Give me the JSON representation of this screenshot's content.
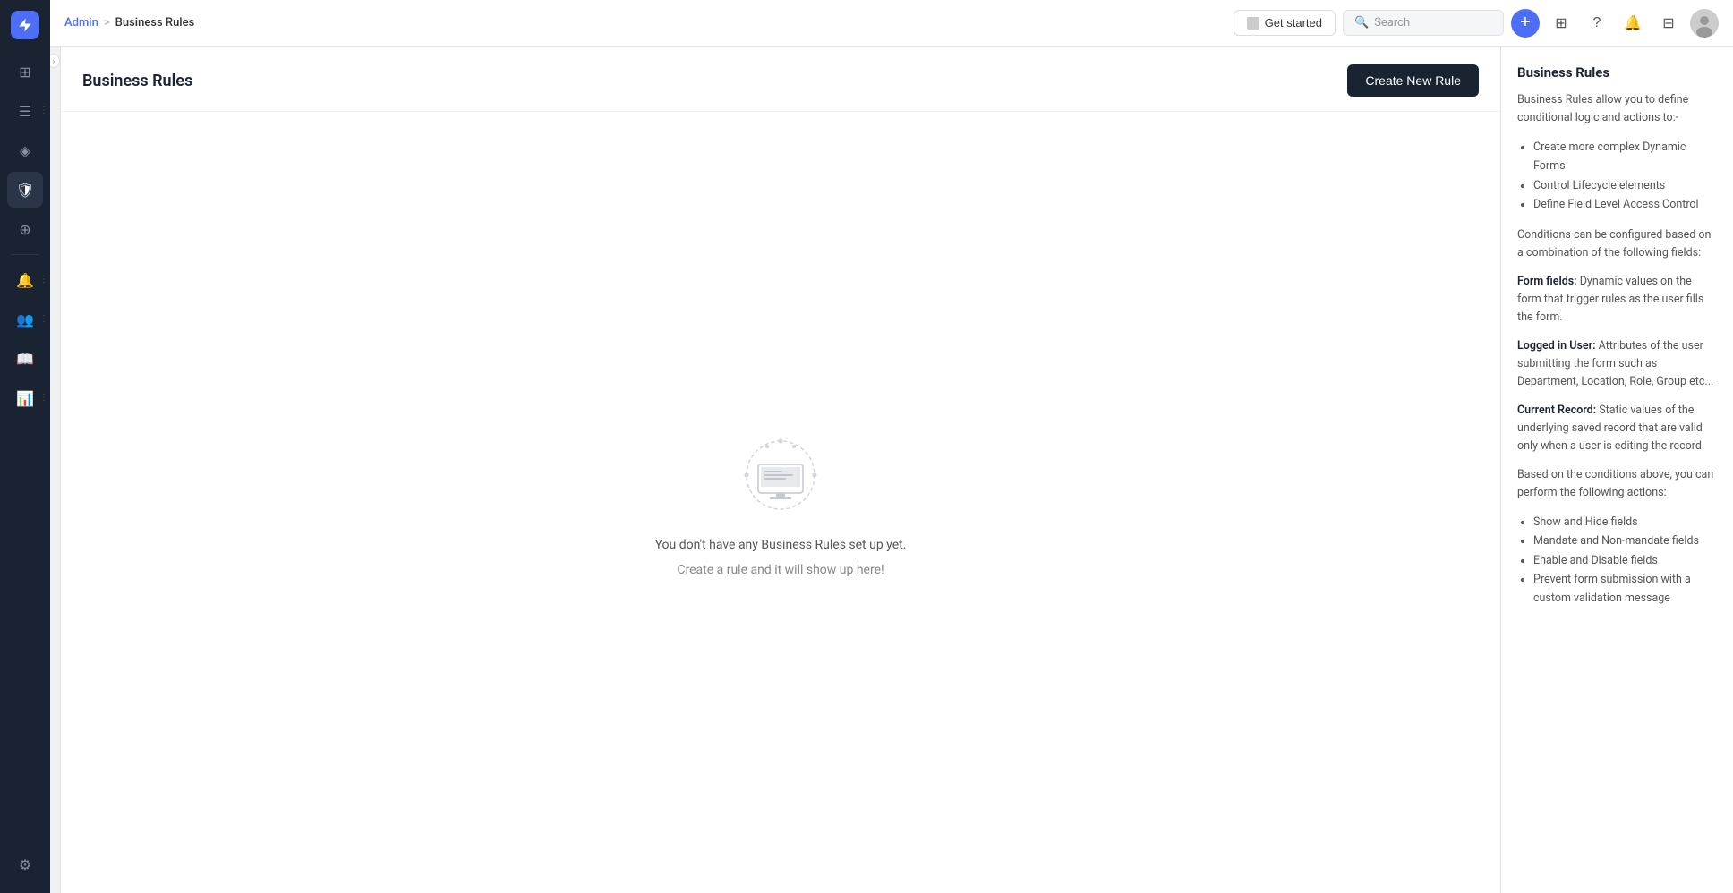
{
  "sidebar": {
    "logo_icon": "⚡",
    "collapse_arrow": "›",
    "items": [
      {
        "id": "dashboard",
        "icon": "⊞",
        "label": "Dashboard"
      },
      {
        "id": "forms",
        "icon": "☰",
        "label": "Forms"
      },
      {
        "id": "analytics",
        "icon": "📊",
        "label": "Analytics"
      },
      {
        "id": "shield",
        "icon": "🛡",
        "label": "Shield"
      },
      {
        "id": "globe",
        "icon": "🌐",
        "label": "Globe"
      },
      {
        "id": "bell",
        "icon": "🔔",
        "label": "Notifications"
      },
      {
        "id": "users",
        "icon": "👥",
        "label": "Users"
      },
      {
        "id": "book",
        "icon": "📖",
        "label": "Book"
      },
      {
        "id": "chart",
        "icon": "📈",
        "label": "Chart"
      },
      {
        "id": "settings",
        "icon": "⚙",
        "label": "Settings"
      }
    ]
  },
  "topnav": {
    "breadcrumb_admin": "Admin",
    "breadcrumb_sep": ">",
    "breadcrumb_current": "Business Rules",
    "get_started_label": "Get started",
    "search_placeholder": "Search",
    "plus_icon": "+",
    "grid_icon": "⊞",
    "help_icon": "?",
    "bell_icon": "🔔",
    "apps_icon": "⊞"
  },
  "page": {
    "title": "Business Rules",
    "create_button_label": "Create New Rule",
    "empty_state_line1": "You don't have any Business Rules set up yet.",
    "empty_state_line2": "Create a rule and it will show up here!"
  },
  "right_panel": {
    "title": "Business Rules",
    "description": "Business Rules allow you to define conditional logic and actions to:-",
    "bullet_items": [
      "Create more complex Dynamic Forms",
      "Control Lifecycle elements",
      "Define Field Level Access Control"
    ],
    "conditions_heading": "Conditions can be configured based on a combination of the following fields:",
    "form_fields_label": "Form fields:",
    "form_fields_text": "Dynamic values on the form that trigger rules as the user fills the form.",
    "logged_in_label": "Logged in User:",
    "logged_in_text": "Attributes of the user submitting the form such as Department, Location, Role, Group etc...",
    "current_record_label": "Current Record:",
    "current_record_text": "Static values of the underlying saved record that are valid only when a user is editing the record.",
    "actions_heading": "Based on the conditions above, you can perform the following actions:",
    "action_items": [
      "Show and Hide fields",
      "Mandate and Non-mandate fields",
      "Enable and Disable fields",
      "Prevent form submission with a custom validation message"
    ]
  }
}
